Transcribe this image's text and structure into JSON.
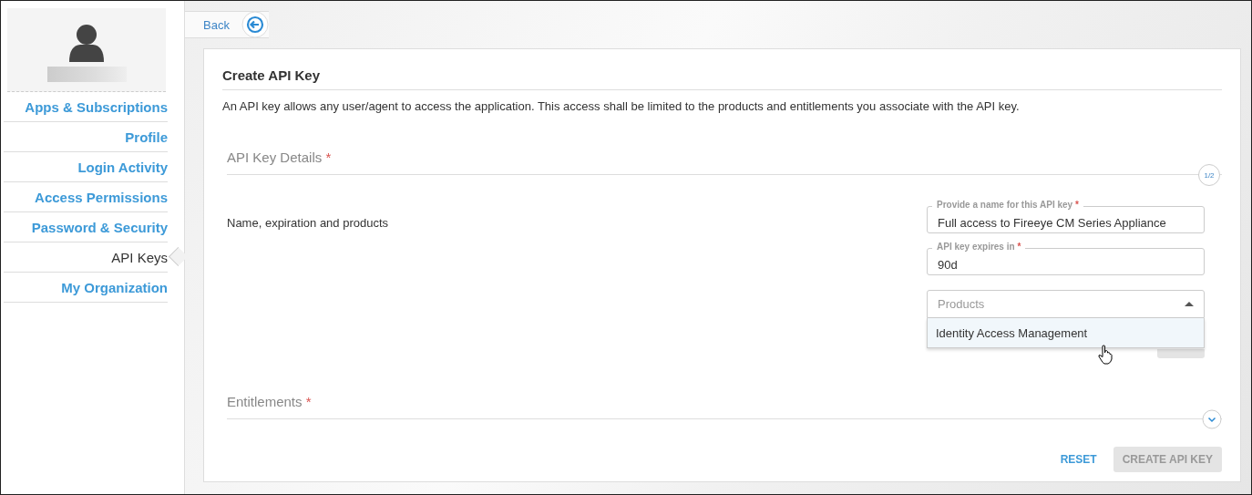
{
  "sidebar": {
    "items": [
      {
        "label": "Apps & Subscriptions",
        "selected": false
      },
      {
        "label": "Profile",
        "selected": false
      },
      {
        "label": "Login Activity",
        "selected": false
      },
      {
        "label": "Access Permissions",
        "selected": false
      },
      {
        "label": "Password & Security",
        "selected": false
      },
      {
        "label": "API Keys",
        "selected": true
      },
      {
        "label": "My Organization",
        "selected": false
      }
    ]
  },
  "back_button": {
    "label": "Back"
  },
  "card": {
    "title": "Create API Key",
    "description": "An API key allows any user/agent to access the application. This access shall be limited to the products and entitlements you associate with the API key.",
    "sections": [
      {
        "title": "API Key Details",
        "mark": "*",
        "step": "1/2",
        "expanded": true,
        "subtitle": "Name, expiration and products",
        "fields": [
          {
            "kind": "text",
            "label": "Provide a name for this API key",
            "mark": "*",
            "value": "Full access to Fireeye CM Series Appliance"
          },
          {
            "kind": "text",
            "label": "API key expires in",
            "mark": "*",
            "value": "90d"
          },
          {
            "kind": "select",
            "placeholder": "Products",
            "expanded": true,
            "options": [
              "Identity Access Management"
            ]
          }
        ]
      },
      {
        "title": "Entitlements",
        "mark": "*",
        "expanded": false
      }
    ],
    "buttons": [
      {
        "label": "RESET",
        "kind": "link",
        "disabled": false
      },
      {
        "label": "CREATE API KEY",
        "kind": "primary",
        "disabled": true
      }
    ]
  }
}
